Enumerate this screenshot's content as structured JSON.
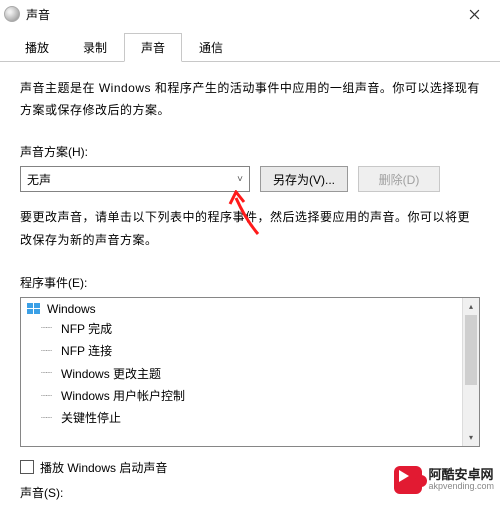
{
  "window": {
    "title": "声音"
  },
  "tabs": {
    "playback": "播放",
    "record": "录制",
    "sound": "声音",
    "comm": "通信"
  },
  "intro": "声音主题是在 Windows 和程序产生的活动事件中应用的一组声音。你可以选择现有方案或保存修改后的方案。",
  "scheme": {
    "label": "声音方案(H):",
    "value": "无声",
    "save_as": "另存为(V)...",
    "delete": "删除(D)"
  },
  "note": "要更改声音，请单击以下列表中的程序事件，然后选择要应用的声音。你可以将更改保存为新的声音方案。",
  "events": {
    "label": "程序事件(E):",
    "root": "Windows",
    "items": [
      "NFP 完成",
      "NFP 连接",
      "Windows 更改主题",
      "Windows 用户帐户控制",
      "关键性停止"
    ]
  },
  "play_startup": "播放 Windows 启动声音",
  "sounds_label": "声音(S):",
  "watermark": {
    "cn": "阿酷安卓网",
    "en": "akpvending.com"
  }
}
